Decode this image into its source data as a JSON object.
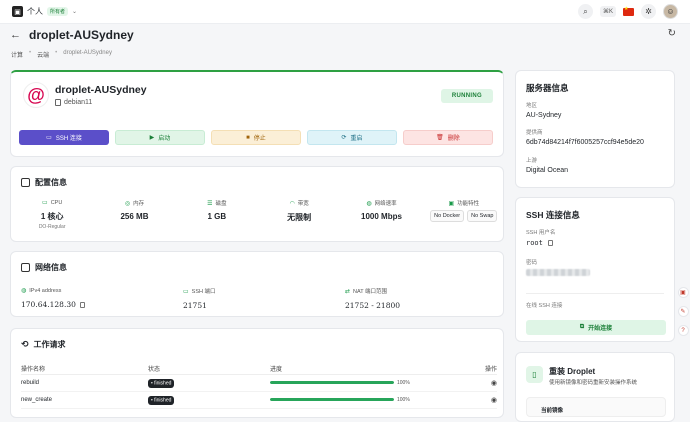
{
  "topbar": {
    "workspace": "个人",
    "owner_badge": "所有者",
    "shortcut": "⌘K"
  },
  "page": {
    "title": "droplet-AUSydney",
    "breadcrumbs": [
      "计算",
      "云端",
      "droplet-AUSydney"
    ]
  },
  "hero": {
    "name": "droplet-AUSydney",
    "os": "debian11",
    "status": "RUNNING",
    "actions": {
      "ssh": "SSH 连接",
      "start": "启动",
      "stop": "停止",
      "restart": "重启",
      "delete": "删除"
    }
  },
  "config": {
    "title": "配置信息",
    "cpu_label": "CPU",
    "cpu_value": "1 核心",
    "cpu_sub": "DO-Regular",
    "memory_label": "内存",
    "memory_value": "256 MB",
    "disk_label": "磁盘",
    "disk_value": "1 GB",
    "bandwidth_label": "带宽",
    "bandwidth_value": "无限制",
    "speed_label": "网络速率",
    "speed_value": "1000 Mbps",
    "features_label": "功能特性",
    "features": [
      "No Docker",
      "No Swap"
    ]
  },
  "network": {
    "title": "网络信息",
    "ipv4_label": "IPv4 address",
    "ipv4_value": "170.64.128.30",
    "ssh_port_label": "SSH 端口",
    "ssh_port_value": "21751",
    "nat_label": "NAT 端口范围",
    "nat_value": "21752 - 21800"
  },
  "jobs": {
    "title": "工作请求",
    "headers": {
      "name": "操作名称",
      "status": "状态",
      "progress": "进度",
      "action": "操作"
    },
    "rows": [
      {
        "name": "rebuild",
        "status": "finished",
        "progress": 100,
        "progress_label": "100%"
      },
      {
        "name": "new_create",
        "status": "finished",
        "progress": 100,
        "progress_label": "100%"
      }
    ]
  },
  "server": {
    "title": "服务器信息",
    "region_label": "地区",
    "region_value": "AU-Sydney",
    "id_label": "提供商",
    "id_value": "6db74d84214f7f6005257ccf94e5de20",
    "provider_label": "上游",
    "provider_value": "Digital Ocean"
  },
  "ssh": {
    "title": "SSH 连接信息",
    "user_label": "SSH 用户名",
    "user_value": "root",
    "password_label": "密码",
    "online_label": "在线 SSH 连接",
    "connect_button": "开始连接"
  },
  "reinstall": {
    "title": "重装 Droplet",
    "desc": "使用新镜像和密码重新安装操作系统",
    "current": "当前镜像"
  }
}
